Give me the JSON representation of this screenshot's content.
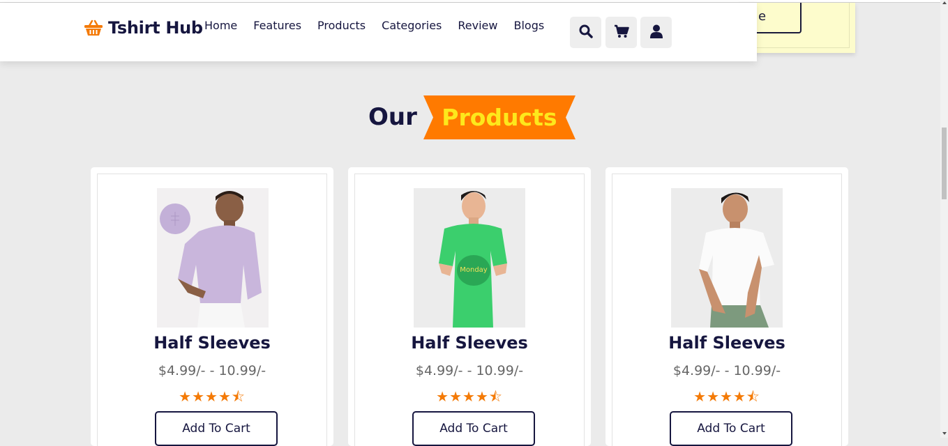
{
  "brand": {
    "name": "Tshirt Hub",
    "icon": "basket-icon",
    "accent": "#f47a06",
    "dark": "#16163f"
  },
  "nav": {
    "items": [
      "Home",
      "Features",
      "Products",
      "Categories",
      "Review",
      "Blogs"
    ]
  },
  "header_icons": [
    "search-icon",
    "cart-icon",
    "user-icon"
  ],
  "popup": {
    "button_text": "e",
    "background": "#fdfccc"
  },
  "section": {
    "title_plain": "Our",
    "title_highlight": "Products",
    "badge_color": "#ff7a00",
    "highlight_color": "#fde81c"
  },
  "products": [
    {
      "name": "Half Sleeves",
      "price": "$4.99/- - 10.99/-",
      "rating": 4.5,
      "stars": "★★★★⯪",
      "button": "Add To Cart",
      "image": "lavender-henley-model"
    },
    {
      "name": "Half Sleeves",
      "price": "$4.99/- - 10.99/-",
      "rating": 4.5,
      "stars": "★★★★⯪",
      "button": "Add To Cart",
      "image": "green-graphic-tee-model"
    },
    {
      "name": "Half Sleeves",
      "price": "$4.99/- - 10.99/-",
      "rating": 4.5,
      "stars": "★★★★⯪",
      "button": "Add To Cart",
      "image": "white-tee-model"
    }
  ]
}
